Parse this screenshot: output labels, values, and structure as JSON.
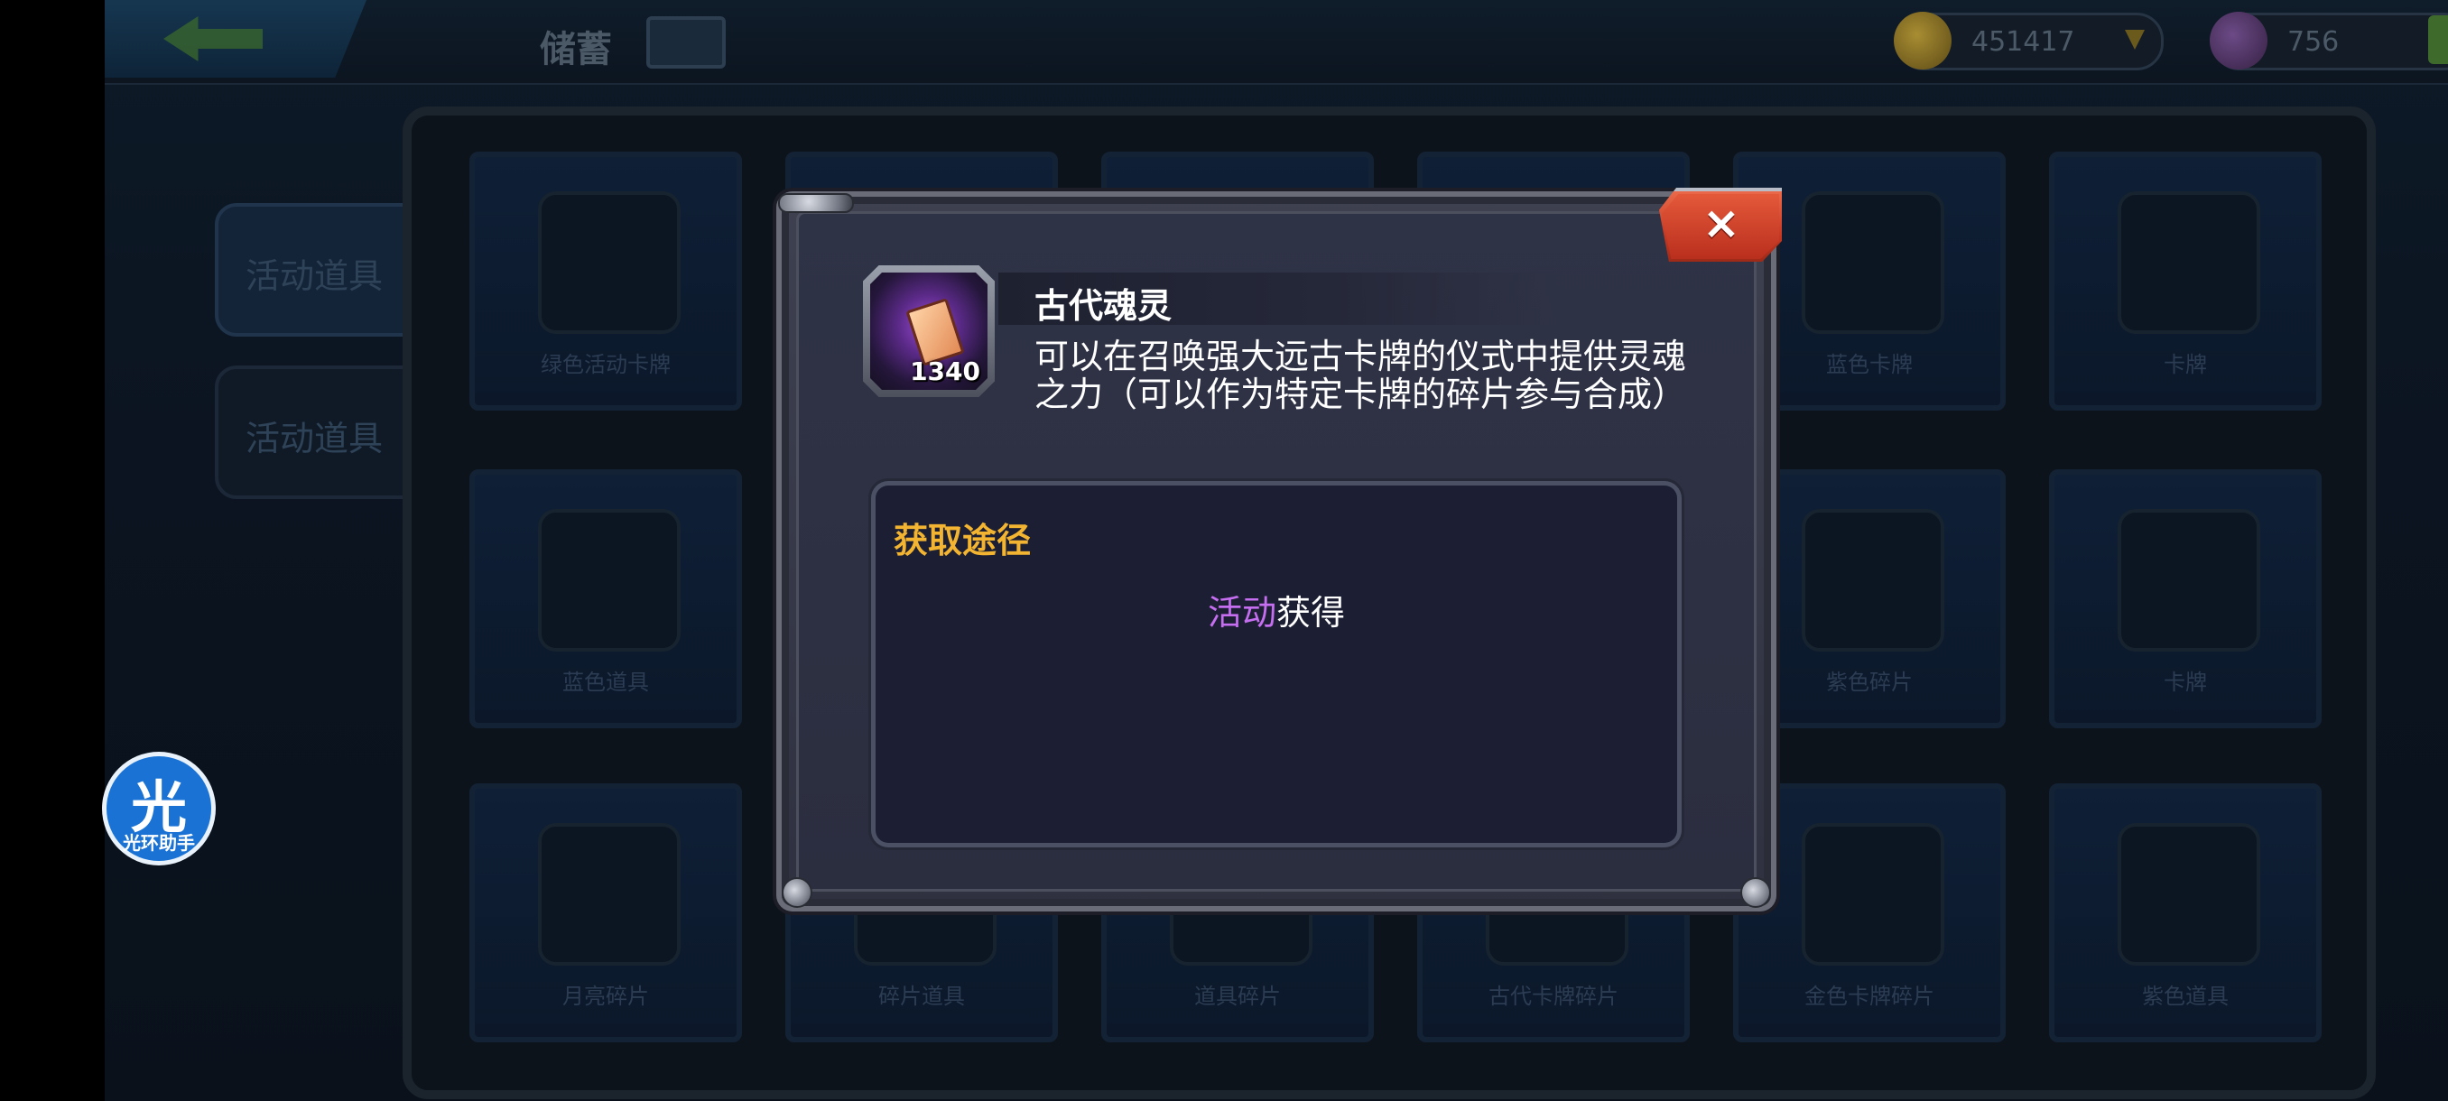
{
  "background": {
    "top_title": "储蓄",
    "gold_value": "451417",
    "gem_value": "756",
    "side_tabs": [
      "活动道具",
      "活动道具"
    ],
    "cards": [
      {
        "caption": "绿色活动卡牌"
      },
      {
        "caption": ""
      },
      {
        "caption": ""
      },
      {
        "caption": ""
      },
      {
        "caption": "蓝色卡牌"
      },
      {
        "caption": "卡牌"
      },
      {
        "caption": "蓝色道具"
      },
      {
        "caption": ""
      },
      {
        "caption": ""
      },
      {
        "caption": ""
      },
      {
        "caption": "紫色碎片"
      },
      {
        "caption": "卡牌"
      },
      {
        "caption": "月亮碎片"
      },
      {
        "caption": "碎片道具"
      },
      {
        "caption": "道具碎片"
      },
      {
        "caption": "古代卡牌碎片"
      },
      {
        "caption": "金色卡牌碎片"
      },
      {
        "caption": "紫色道具"
      }
    ]
  },
  "dialog": {
    "item": {
      "icon": "ancient-soul-icon",
      "name": "古代魂灵",
      "count": "1340",
      "description": "可以在召唤强大远古卡牌的仪式中提供灵魂之力（可以作为特定卡牌的碎片参与合成）"
    },
    "source": {
      "title": "获取途径",
      "highlight": "活动",
      "suffix": "获得"
    },
    "close_label": "×"
  },
  "assistant": {
    "glyph": "光",
    "label": "光环助手"
  },
  "colors": {
    "source_title": "#f3b531",
    "source_highlight": "#c56ef0",
    "close_button": "#d8462c",
    "assistant": "#1a73d4"
  }
}
